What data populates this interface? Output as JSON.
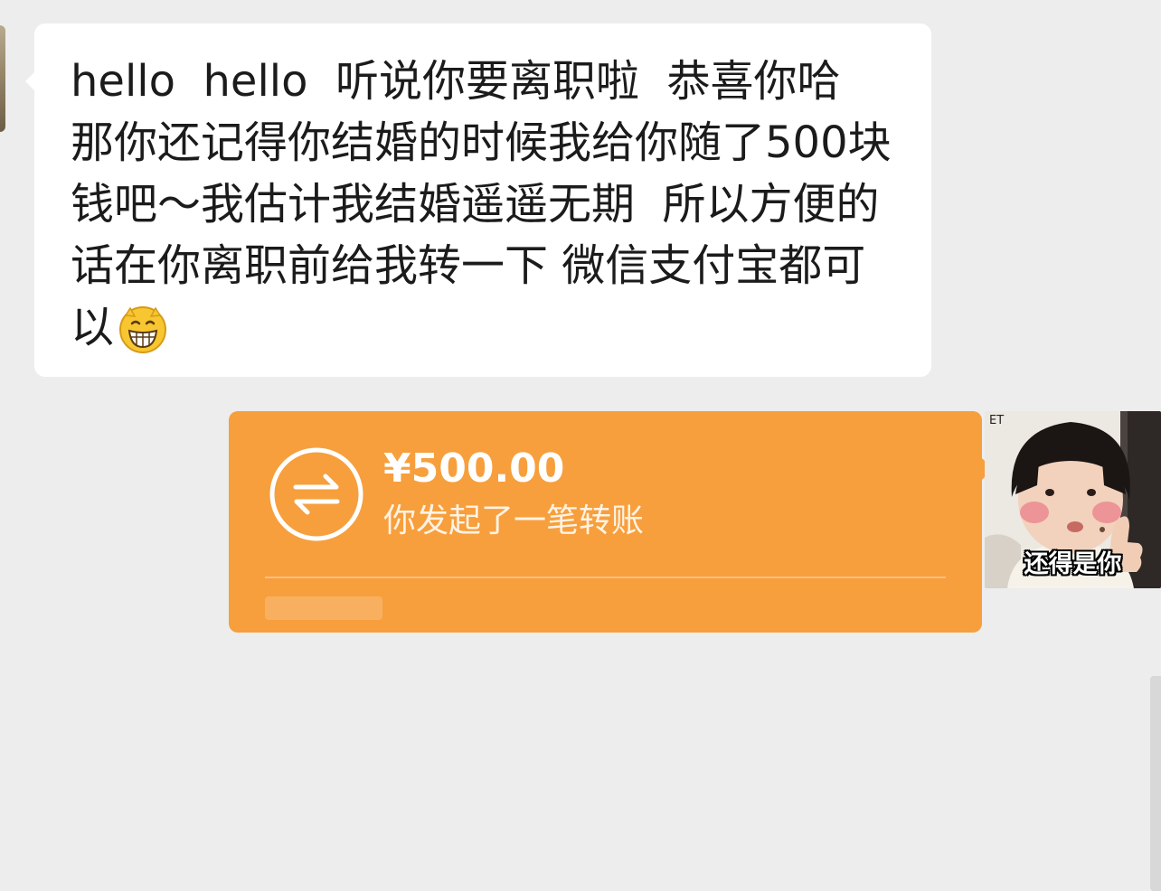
{
  "chat": {
    "incoming_message": {
      "text": "hello  hello  听说你要离职啦  恭喜你哈 那你还记得你结婚的时候我给你随了500块钱吧～我估计我结婚遥遥无期  所以方便的话在你离职前给我转一下 微信支付宝都可以",
      "emoji": "grinning-face"
    },
    "transfer": {
      "amount": "¥500.00",
      "status": "你发起了一笔转账",
      "icon": "transfer-arrows-icon"
    },
    "sticker": {
      "caption": "还得是你",
      "mark": "ET"
    }
  },
  "colors": {
    "background": "#ededed",
    "incoming_bubble": "#ffffff",
    "transfer_card": "#f79f3d",
    "text": "#1b1b1b"
  }
}
